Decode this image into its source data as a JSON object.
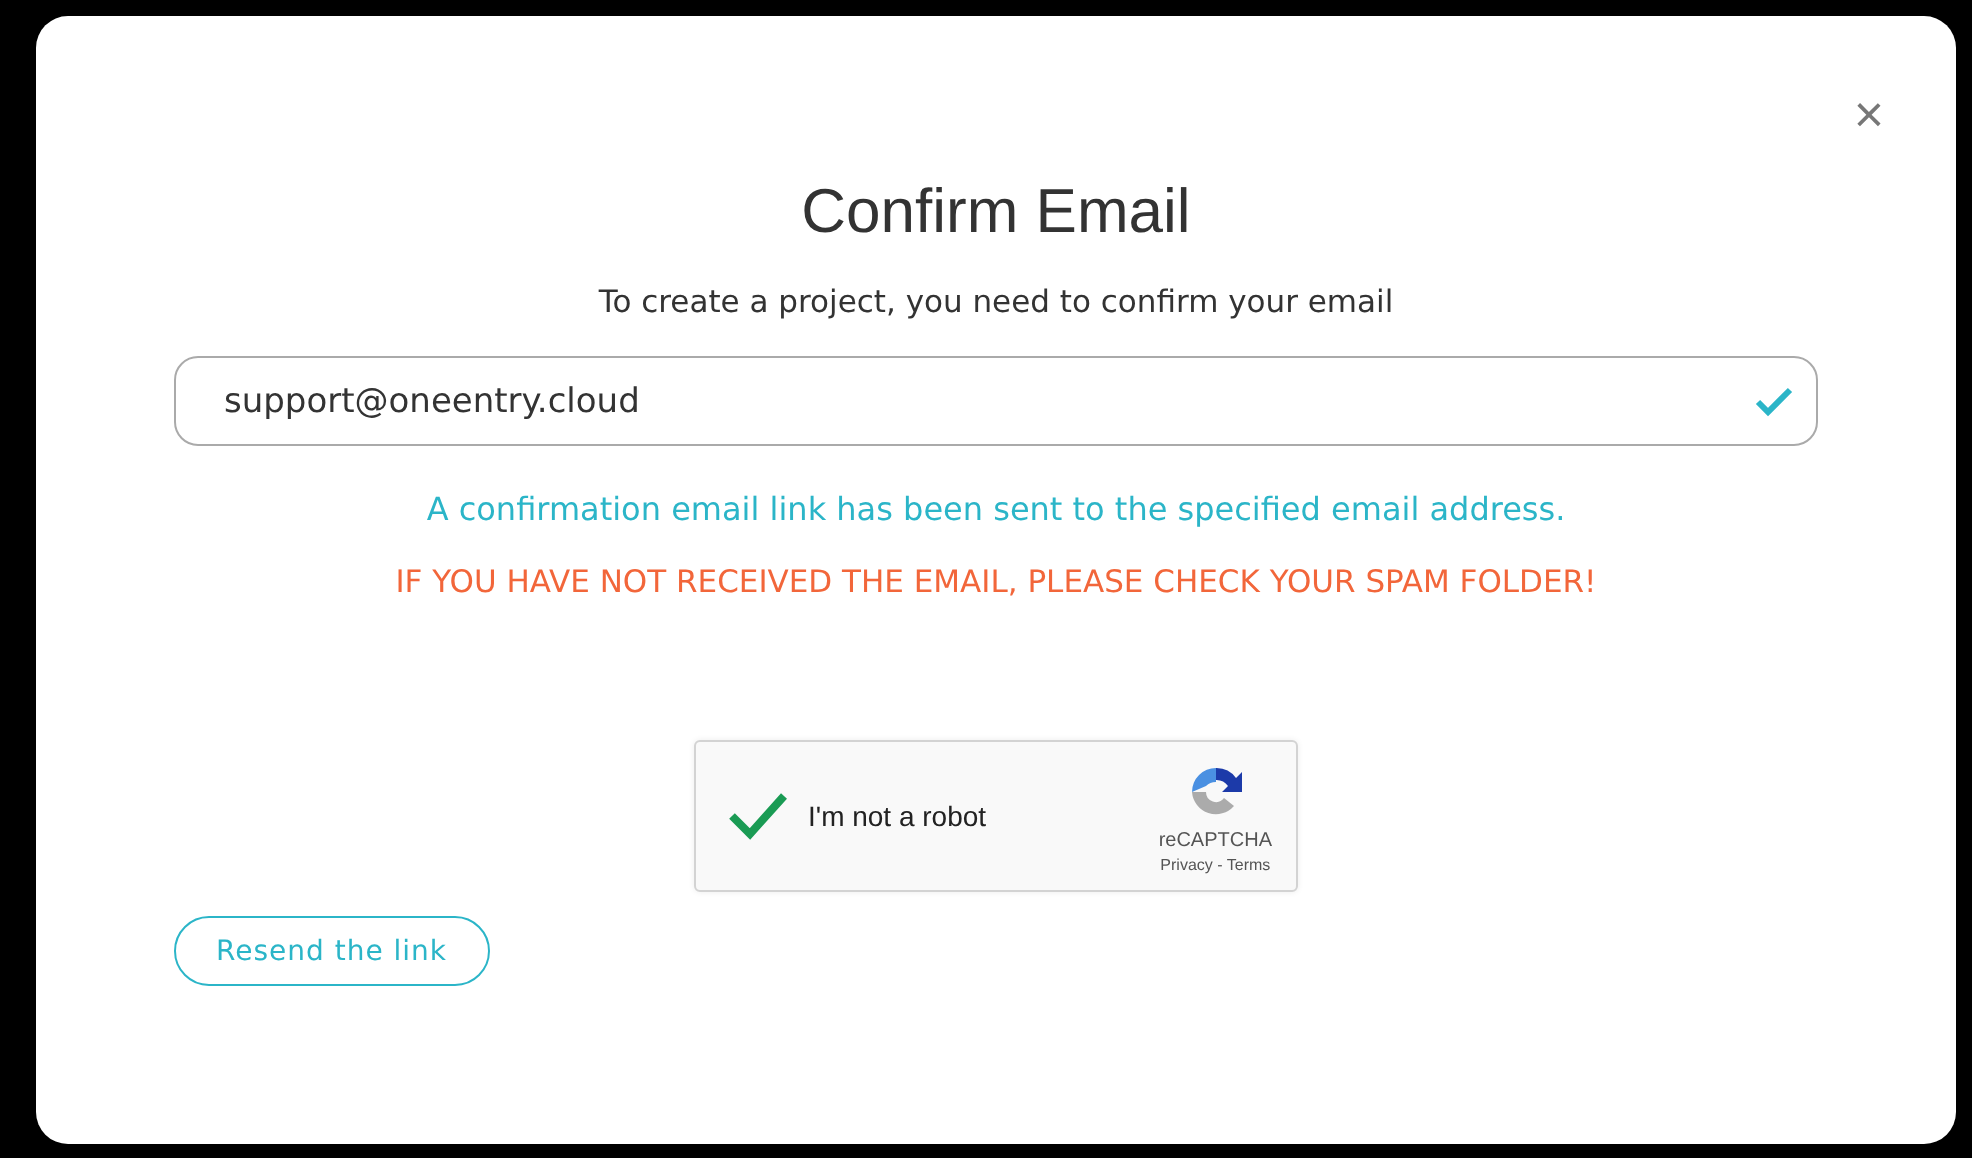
{
  "dialog": {
    "close": "×",
    "title": "Confirm Email",
    "subtitle": "To create a project, you need to confirm your email"
  },
  "email_field": {
    "value": "support@oneentry.cloud",
    "valid": true
  },
  "messages": [
    {
      "kind": "info",
      "text": "A confirmation email link has been sent to the specified email address."
    },
    {
      "kind": "warning",
      "text": "IF YOU HAVE NOT RECEIVED THE EMAIL, PLEASE CHECK YOUR SPAM FOLDER!"
    }
  ],
  "captcha": {
    "label": "I'm not a robot",
    "checked": true,
    "brand": "reCAPTCHA",
    "links": "Privacy - Terms"
  },
  "buttons": [
    {
      "label": "Resend the link"
    }
  ]
}
